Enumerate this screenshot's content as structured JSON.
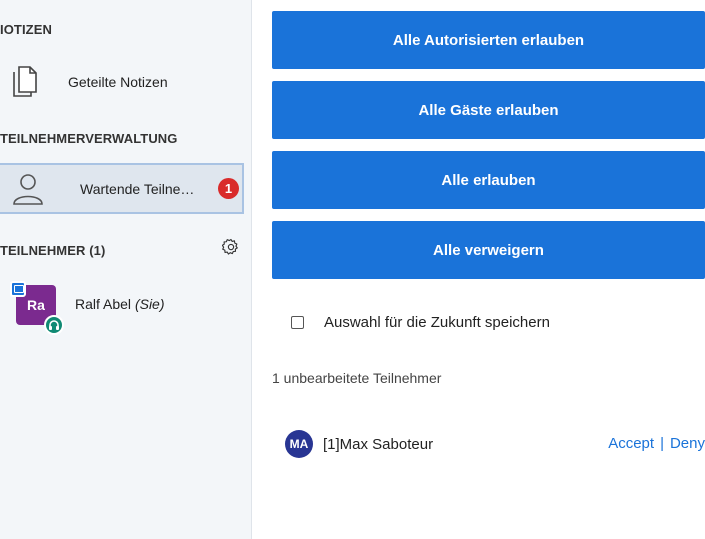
{
  "sidebar": {
    "notes_title": "IOTIZEN",
    "shared_notes_label": "Geteilte Notizen",
    "management_title": "TEILNEHMERVERWALTUNG",
    "waiting_label": "Wartende Teilne…",
    "waiting_badge": "1",
    "users_title": "TEILNEHMER (1)",
    "user": {
      "initials": "Ra",
      "name": "Ralf Abel",
      "self_tag": "(Sie)"
    }
  },
  "main": {
    "buttons": {
      "allow_authenticated": "Alle Autorisierten erlauben",
      "allow_guests": "Alle Gäste erlauben",
      "allow_all": "Alle erlauben",
      "deny_all": "Alle verweigern"
    },
    "remember_label": "Auswahl für die Zukunft speichern",
    "pending_count_label": "1 unbearbeitete Teilnehmer",
    "guest": {
      "initials": "MA",
      "name": "[1]Max Saboteur",
      "accept_label": "Accept",
      "separator": "|",
      "deny_label": "Deny"
    }
  },
  "colors": {
    "primary": "#1a73d9",
    "sidebar_bg": "#f3f6f9",
    "badge_red": "#d92b2b",
    "user_avatar": "#7b2a8f",
    "guest_avatar": "#283593",
    "audio_green": "#108a74"
  },
  "icons": {
    "shared_notes": "document-icon",
    "waiting_users": "user-outline-icon",
    "settings": "gear-icon",
    "presenter": "presenter-icon",
    "audio": "headset-icon"
  }
}
